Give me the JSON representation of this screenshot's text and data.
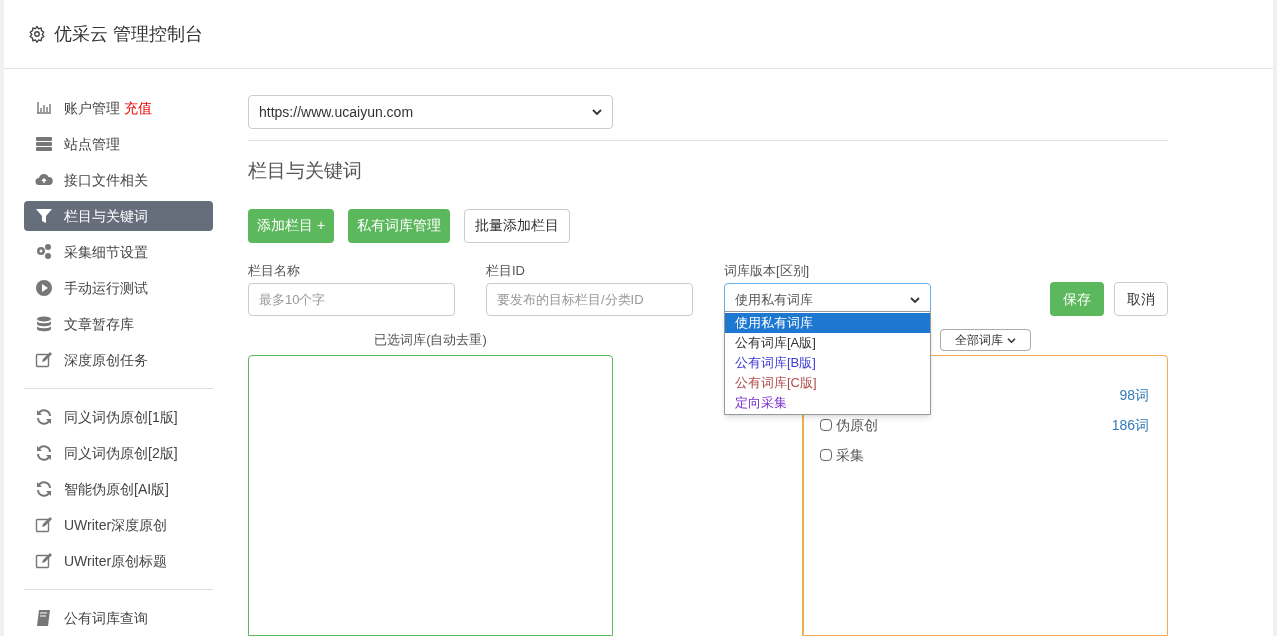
{
  "header": {
    "title": "优采云 管理控制台"
  },
  "sidebar": {
    "groups": [
      {
        "items": [
          {
            "label": "账户管理",
            "badge": "充值",
            "selected": false
          },
          {
            "label": "站点管理",
            "selected": false
          },
          {
            "label": "接口文件相关",
            "selected": false
          },
          {
            "label": "栏目与关键词",
            "selected": true
          },
          {
            "label": "采集细节设置",
            "selected": false
          },
          {
            "label": "手动运行测试",
            "selected": false
          },
          {
            "label": "文章暂存库",
            "selected": false
          },
          {
            "label": "深度原创任务",
            "selected": false
          }
        ]
      },
      {
        "items": [
          {
            "label": "同义词伪原创[1版]",
            "selected": false
          },
          {
            "label": "同义词伪原创[2版]",
            "selected": false
          },
          {
            "label": "智能伪原创[AI版]",
            "selected": false
          },
          {
            "label": "UWriter深度原创",
            "selected": false
          },
          {
            "label": "UWriter原创标题",
            "selected": false
          }
        ]
      },
      {
        "items": [
          {
            "label": "公有词库查询",
            "selected": false
          }
        ]
      }
    ]
  },
  "site_select": {
    "value": "https://www.ucaiyun.com"
  },
  "section_title": "栏目与关键词",
  "buttons": [
    {
      "label": "添加栏目 +",
      "kind": "primary"
    },
    {
      "label": "私有词库管理",
      "kind": "primary"
    },
    {
      "label": "批量添加栏目",
      "kind": "outline"
    }
  ],
  "form": {
    "fields": [
      {
        "label": "栏目名称",
        "placeholder": "最多10个字",
        "kind": "input"
      },
      {
        "label": "栏目ID",
        "placeholder": "要发布的目标栏目/分类ID",
        "kind": "input"
      },
      {
        "label": "词库版本[区别]",
        "value": "使用私有词库",
        "kind": "select",
        "expanded": true,
        "options": [
          {
            "label": "使用私有词库",
            "selected": true
          },
          {
            "label": "公有词库[A版]",
            "selected": false,
            "color": "#333333"
          },
          {
            "label": "公有词库[B版]",
            "selected": false,
            "color": "#3b3bd6"
          },
          {
            "label": "公有词库[C版]",
            "selected": false,
            "color": "#b04a4a"
          },
          {
            "label": "定向采集",
            "selected": false,
            "color": "#7a2fd0"
          }
        ]
      }
    ],
    "save": "保存",
    "cancel": "取消"
  },
  "selected_panel": {
    "title": "已选词库(自动去重)"
  },
  "library_panel": {
    "filter": "全部词库",
    "rows": [
      {
        "count": "98词"
      },
      {
        "label": "伪原创",
        "checked": false,
        "count": "186词"
      },
      {
        "label": "采集",
        "checked": false
      }
    ]
  }
}
